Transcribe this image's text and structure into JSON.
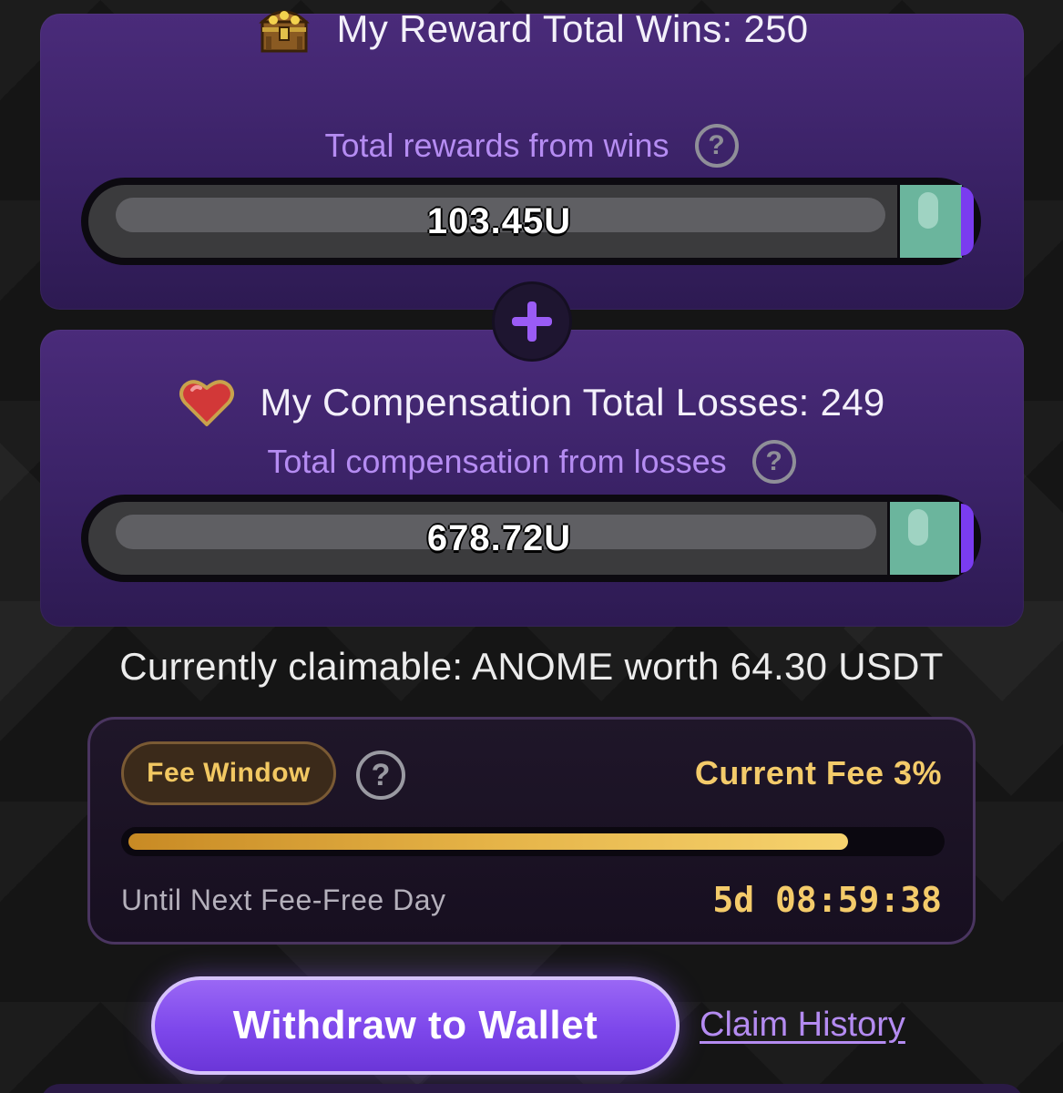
{
  "reward": {
    "icon": "treasure-chest-icon",
    "title": "My Reward Total Wins: 250",
    "subtitle": "Total rewards from wins",
    "help_icon": "help-circle-icon",
    "bar_value": "103.45U"
  },
  "plus_icon": "plus-icon",
  "compensation": {
    "icon": "heart-icon",
    "title": "My Compensation Total Losses: 249",
    "subtitle": "Total compensation from losses",
    "help_icon": "help-circle-icon",
    "bar_value": "678.72U"
  },
  "claimable_text": "Currently claimable: ANOME worth 64.30 USDT",
  "fee": {
    "window_label": "Fee Window",
    "help_icon": "help-circle-icon",
    "current_fee": "Current Fee 3%",
    "progress_fraction": 0.89,
    "until_label": "Until Next Fee-Free Day",
    "countdown": "5d 08:59:38"
  },
  "actions": {
    "withdraw_label": "Withdraw to Wallet",
    "claim_history_label": "Claim History"
  },
  "colors": {
    "card_purple": "#4a2b7a",
    "accent_purple": "#b58cf2",
    "bar_teal": "#6bb59d",
    "fee_gold": "#f4cb6a",
    "button_purple": "#7d47eb"
  }
}
